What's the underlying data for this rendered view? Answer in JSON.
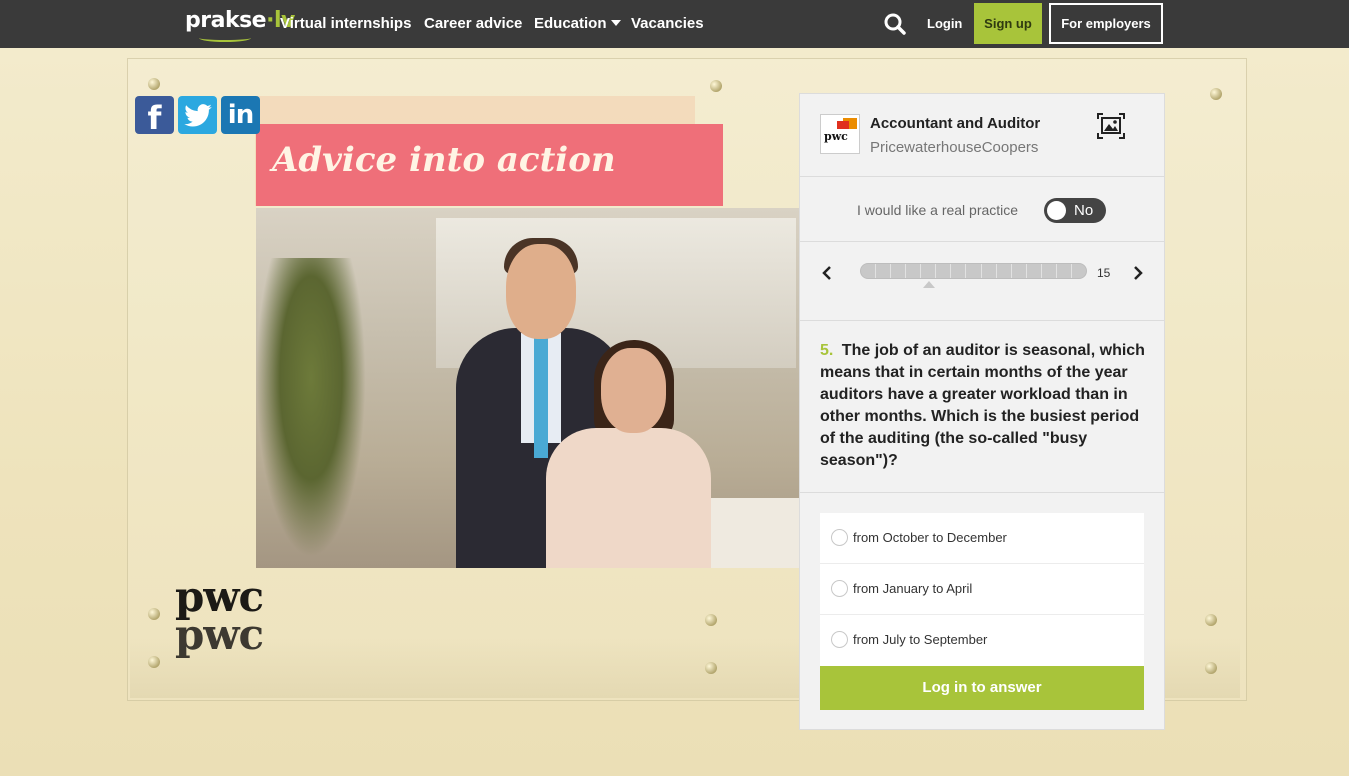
{
  "nav": {
    "logo_main": "prakse",
    "logo_dot": "·",
    "logo_tld": "lv",
    "links": [
      "Virtual internships",
      "Career advice",
      "Education",
      "Vacancies"
    ],
    "search_icon": "search-icon",
    "login": "Login",
    "signup": "Sign up",
    "employers": "For employers"
  },
  "hero": {
    "banner_text": "Advice into action",
    "brand_mark": "pwc",
    "brand_mark_reflection": "pwc"
  },
  "social": {
    "facebook_glyph": "f",
    "linkedin_glyph": "in",
    "icons": [
      "facebook-icon",
      "twitter-icon",
      "linkedin-icon"
    ]
  },
  "panel": {
    "company_logo_text": "pwc",
    "job_title": "Accountant and Auditor",
    "company": "PricewaterhouseCoopers",
    "practice_label": "I would like a real practice",
    "practice_toggle": "No",
    "progress": {
      "total": "15",
      "current_question": 5
    },
    "question_number": "5.",
    "question_text": "The job of an auditor is seasonal, which means that in certain months of the year auditors have a greater workload than in other months. Which is the busiest period of the auditing (the so-called \"busy season\")?",
    "answers": [
      "from October to December",
      "from January to April",
      "from July to September"
    ],
    "submit": "Log in to answer"
  },
  "colors": {
    "nav_bg": "#3a3a3a",
    "accent_green": "#a8c43a",
    "banner_pink": "#ef6f79",
    "panel_bg": "#f2f2f2"
  }
}
